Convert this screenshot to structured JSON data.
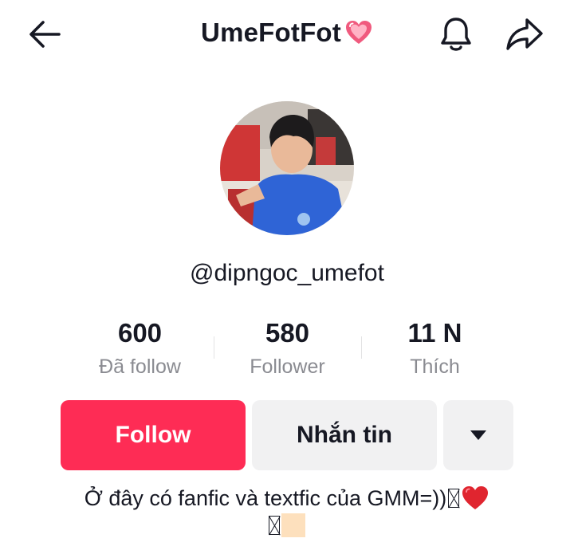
{
  "header": {
    "title": "UmeFotFot",
    "back_icon": "arrow-left-icon",
    "bell_icon": "bell-icon",
    "share_icon": "share-arrow-icon",
    "title_emoji": "sparkling-heart-icon"
  },
  "profile": {
    "handle": "@dipngoc_umefot",
    "avatar": "profile-photo"
  },
  "stats": [
    {
      "value": "600",
      "label": "Đã follow"
    },
    {
      "value": "580",
      "label": "Follower"
    },
    {
      "value": "11 N",
      "label": "Thích"
    }
  ],
  "actions": {
    "follow_label": "Follow",
    "message_label": "Nhắn tin",
    "more_icon": "caret-down-icon"
  },
  "bio": {
    "text": "Ở đây có fanfic và textfic của GMM=))"
  },
  "colors": {
    "accent": "#fe2c55",
    "secondary_button": "#f1f1f2",
    "muted_text": "#8a8b91",
    "text": "#161823"
  }
}
